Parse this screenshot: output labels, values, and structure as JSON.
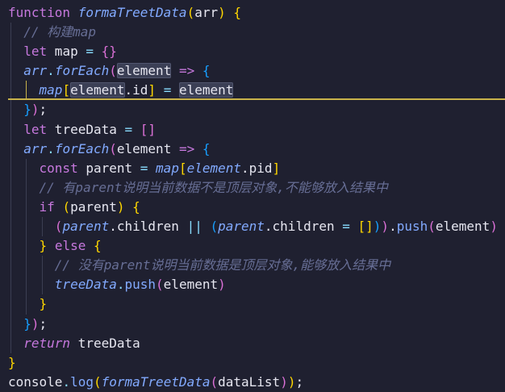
{
  "editor": {
    "colors": {
      "background": "#1f2030",
      "kw": "#c678dd",
      "kwi": "#c678dd",
      "fn": "#82aaff",
      "mt": "#82aaff",
      "tx": "#e6e6f0",
      "op": "#89ddff",
      "cm": "#676e95",
      "b1": "#ffd700",
      "b2": "#da70d6",
      "b3": "#179fff",
      "hl": "#e6e6f0",
      "indent_guide": "#3b3e52",
      "active_guide": "#c8b24a",
      "current_line_border": "#c8b24a"
    },
    "lines": [
      {
        "tokens": [
          {
            "kw": "function"
          },
          {
            "tx": " "
          },
          {
            "fn": "formaTreetData"
          },
          {
            "b1": "("
          },
          {
            "tx": "arr"
          },
          {
            "b1": ")"
          },
          {
            "tx": " "
          },
          {
            "b1": "{"
          }
        ]
      },
      {
        "tokens": [
          {
            "tx": "  "
          },
          {
            "cm": "// 构建map"
          }
        ]
      },
      {
        "tokens": [
          {
            "tx": "  "
          },
          {
            "kw": "let"
          },
          {
            "tx": " map "
          },
          {
            "op": "="
          },
          {
            "tx": " "
          },
          {
            "b2": "{}"
          }
        ]
      },
      {
        "tokens": [
          {
            "tx": "  "
          },
          {
            "fn": "arr"
          },
          {
            "op": "."
          },
          {
            "fn": "forEach"
          },
          {
            "b2": "("
          },
          {
            "hl": "element"
          },
          {
            "tx": " "
          },
          {
            "kw": "=>"
          },
          {
            "tx": " "
          },
          {
            "b3": "{"
          }
        ]
      },
      {
        "current": true,
        "tokens": [
          {
            "tx": "    "
          },
          {
            "fn": "map"
          },
          {
            "b1": "["
          },
          {
            "hl": "element"
          },
          {
            "tx": ".id"
          },
          {
            "b1": "]"
          },
          {
            "tx": " "
          },
          {
            "op": "="
          },
          {
            "tx": " "
          },
          {
            "hl": "element"
          }
        ]
      },
      {
        "tokens": [
          {
            "tx": "  "
          },
          {
            "b3": "}"
          },
          {
            "b2": ")"
          },
          {
            "tx": ";"
          }
        ]
      },
      {
        "tokens": [
          {
            "tx": "  "
          },
          {
            "kw": "let"
          },
          {
            "tx": " treeData "
          },
          {
            "op": "="
          },
          {
            "tx": " "
          },
          {
            "b2": "[]"
          }
        ]
      },
      {
        "tokens": [
          {
            "tx": "  "
          },
          {
            "fn": "arr"
          },
          {
            "op": "."
          },
          {
            "fn": "forEach"
          },
          {
            "b2": "("
          },
          {
            "tx": "element "
          },
          {
            "kw": "=>"
          },
          {
            "tx": " "
          },
          {
            "b3": "{"
          }
        ]
      },
      {
        "tokens": [
          {
            "tx": "    "
          },
          {
            "kw": "const"
          },
          {
            "tx": " parent "
          },
          {
            "op": "="
          },
          {
            "tx": " "
          },
          {
            "fn": "map"
          },
          {
            "b1": "["
          },
          {
            "fn": "element"
          },
          {
            "tx": ".pid"
          },
          {
            "b1": "]"
          }
        ]
      },
      {
        "tokens": [
          {
            "tx": "    "
          },
          {
            "cm": "// 有parent说明当前数据不是顶层对象,不能够放入结果中"
          }
        ]
      },
      {
        "tokens": [
          {
            "tx": "    "
          },
          {
            "kw": "if"
          },
          {
            "tx": " "
          },
          {
            "b1": "("
          },
          {
            "tx": "parent"
          },
          {
            "b1": ")"
          },
          {
            "tx": " "
          },
          {
            "b1": "{"
          }
        ]
      },
      {
        "tokens": [
          {
            "tx": "      "
          },
          {
            "b2": "("
          },
          {
            "fn": "parent"
          },
          {
            "tx": ".children "
          },
          {
            "op": "||"
          },
          {
            "tx": " "
          },
          {
            "b3": "("
          },
          {
            "fn": "parent"
          },
          {
            "tx": ".children "
          },
          {
            "op": "="
          },
          {
            "tx": " "
          },
          {
            "b1": "[]"
          },
          {
            "b3": ")"
          },
          {
            "b2": ")"
          },
          {
            "tx": "."
          },
          {
            "mt": "push"
          },
          {
            "b2": "("
          },
          {
            "tx": "element"
          },
          {
            "b2": ")"
          }
        ]
      },
      {
        "tokens": [
          {
            "tx": "    "
          },
          {
            "b1": "}"
          },
          {
            "tx": " "
          },
          {
            "kw": "else"
          },
          {
            "tx": " "
          },
          {
            "b1": "{"
          }
        ]
      },
      {
        "tokens": [
          {
            "tx": "      "
          },
          {
            "cm": "// 没有parent说明当前数据是顶层对象,能够放入结果中"
          }
        ]
      },
      {
        "tokens": [
          {
            "tx": "      "
          },
          {
            "fn": "treeData"
          },
          {
            "op": "."
          },
          {
            "mt": "push"
          },
          {
            "b2": "("
          },
          {
            "tx": "element"
          },
          {
            "b2": ")"
          }
        ]
      },
      {
        "tokens": [
          {
            "tx": "    "
          },
          {
            "b1": "}"
          }
        ]
      },
      {
        "tokens": [
          {
            "tx": "  "
          },
          {
            "b3": "}"
          },
          {
            "b2": ")"
          },
          {
            "tx": ";"
          }
        ]
      },
      {
        "tokens": [
          {
            "tx": "  "
          },
          {
            "kwi": "return"
          },
          {
            "tx": " treeData"
          }
        ]
      },
      {
        "tokens": [
          {
            "b1": "}"
          }
        ]
      },
      {
        "tokens": [
          {
            "tx": "console"
          },
          {
            "op": "."
          },
          {
            "mt": "log"
          },
          {
            "b1": "("
          },
          {
            "fn": "formaTreetData"
          },
          {
            "b2": "("
          },
          {
            "tx": "dataList"
          },
          {
            "b2": ")"
          },
          {
            "b1": ")"
          },
          {
            "tx": ";"
          }
        ]
      }
    ]
  }
}
